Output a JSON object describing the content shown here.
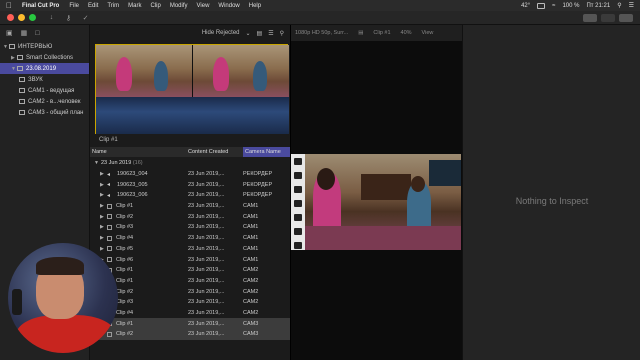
{
  "menubar": {
    "app": "Final Cut Pro",
    "items": [
      "File",
      "Edit",
      "Trim",
      "Mark",
      "Clip",
      "Modify",
      "View",
      "Window",
      "Help"
    ],
    "battery": "100 %",
    "time": "Пт 21:21",
    "temp": "42°"
  },
  "sidebar": {
    "library": "ИНТЕРВЬЮ",
    "items": [
      {
        "label": "Smart Collections",
        "indent": 1
      },
      {
        "label": "23.08.2019",
        "indent": 1,
        "selected": true
      },
      {
        "label": "ЗВУК",
        "indent": 2
      },
      {
        "label": "CAM1 - ведущая",
        "indent": 2
      },
      {
        "label": "CAM2 - в...человек",
        "indent": 2
      },
      {
        "label": "CAM3 - общий план",
        "indent": 2
      }
    ]
  },
  "browser": {
    "filter": "Hide Rejected",
    "clip_label": "Clip #1",
    "columns": {
      "name": "Name",
      "created": "Content Created",
      "camera": "Camera Name"
    },
    "group": "23 Jun 2019",
    "group_count": "(16)",
    "rows": [
      {
        "name": "190623_004",
        "created": "23 Jun 2019,...",
        "camera": "РЕКОРДЕР",
        "kind": "audio"
      },
      {
        "name": "190623_005",
        "created": "23 Jun 2019,...",
        "camera": "РЕКОРДЕР",
        "kind": "audio"
      },
      {
        "name": "190623_006",
        "created": "23 Jun 2019,...",
        "camera": "РЕКОРДЕР",
        "kind": "audio"
      },
      {
        "name": "Clip #1",
        "created": "23 Jun 2019,...",
        "camera": "CAM1",
        "kind": "video"
      },
      {
        "name": "Clip #2",
        "created": "23 Jun 2019,...",
        "camera": "CAM1",
        "kind": "video"
      },
      {
        "name": "Clip #3",
        "created": "23 Jun 2019,...",
        "camera": "CAM1",
        "kind": "video"
      },
      {
        "name": "Clip #4",
        "created": "23 Jun 2019,...",
        "camera": "CAM1",
        "kind": "video"
      },
      {
        "name": "Clip #5",
        "created": "23 Jun 2019,...",
        "camera": "CAM1",
        "kind": "video"
      },
      {
        "name": "Clip #6",
        "created": "23 Jun 2019,...",
        "camera": "CAM1",
        "kind": "video"
      },
      {
        "name": "Clip #1",
        "created": "23 Jun 2019,...",
        "camera": "CAM2",
        "kind": "video"
      },
      {
        "name": "Clip #1",
        "created": "23 Jun 2019,...",
        "camera": "CAM2",
        "kind": "video"
      },
      {
        "name": "Clip #2",
        "created": "23 Jun 2019,...",
        "camera": "CAM2",
        "kind": "video"
      },
      {
        "name": "Clip #3",
        "created": "23 Jun 2019,...",
        "camera": "CAM2",
        "kind": "video"
      },
      {
        "name": "Clip #4",
        "created": "23 Jun 2019,...",
        "camera": "CAM2",
        "kind": "video"
      },
      {
        "name": "Clip #1",
        "created": "23 Jun 2019,...",
        "camera": "CAM3",
        "kind": "video",
        "highlight": true
      },
      {
        "name": "Clip #2",
        "created": "23 Jun 2019,...",
        "camera": "CAM3",
        "kind": "video",
        "highlight": true
      }
    ]
  },
  "viewer": {
    "format": "1080p HD 50p, Surr...",
    "clip": "Clip #1",
    "zoom": "40%",
    "view": "View"
  },
  "inspector": {
    "empty_text": "Nothing to Inspect"
  }
}
